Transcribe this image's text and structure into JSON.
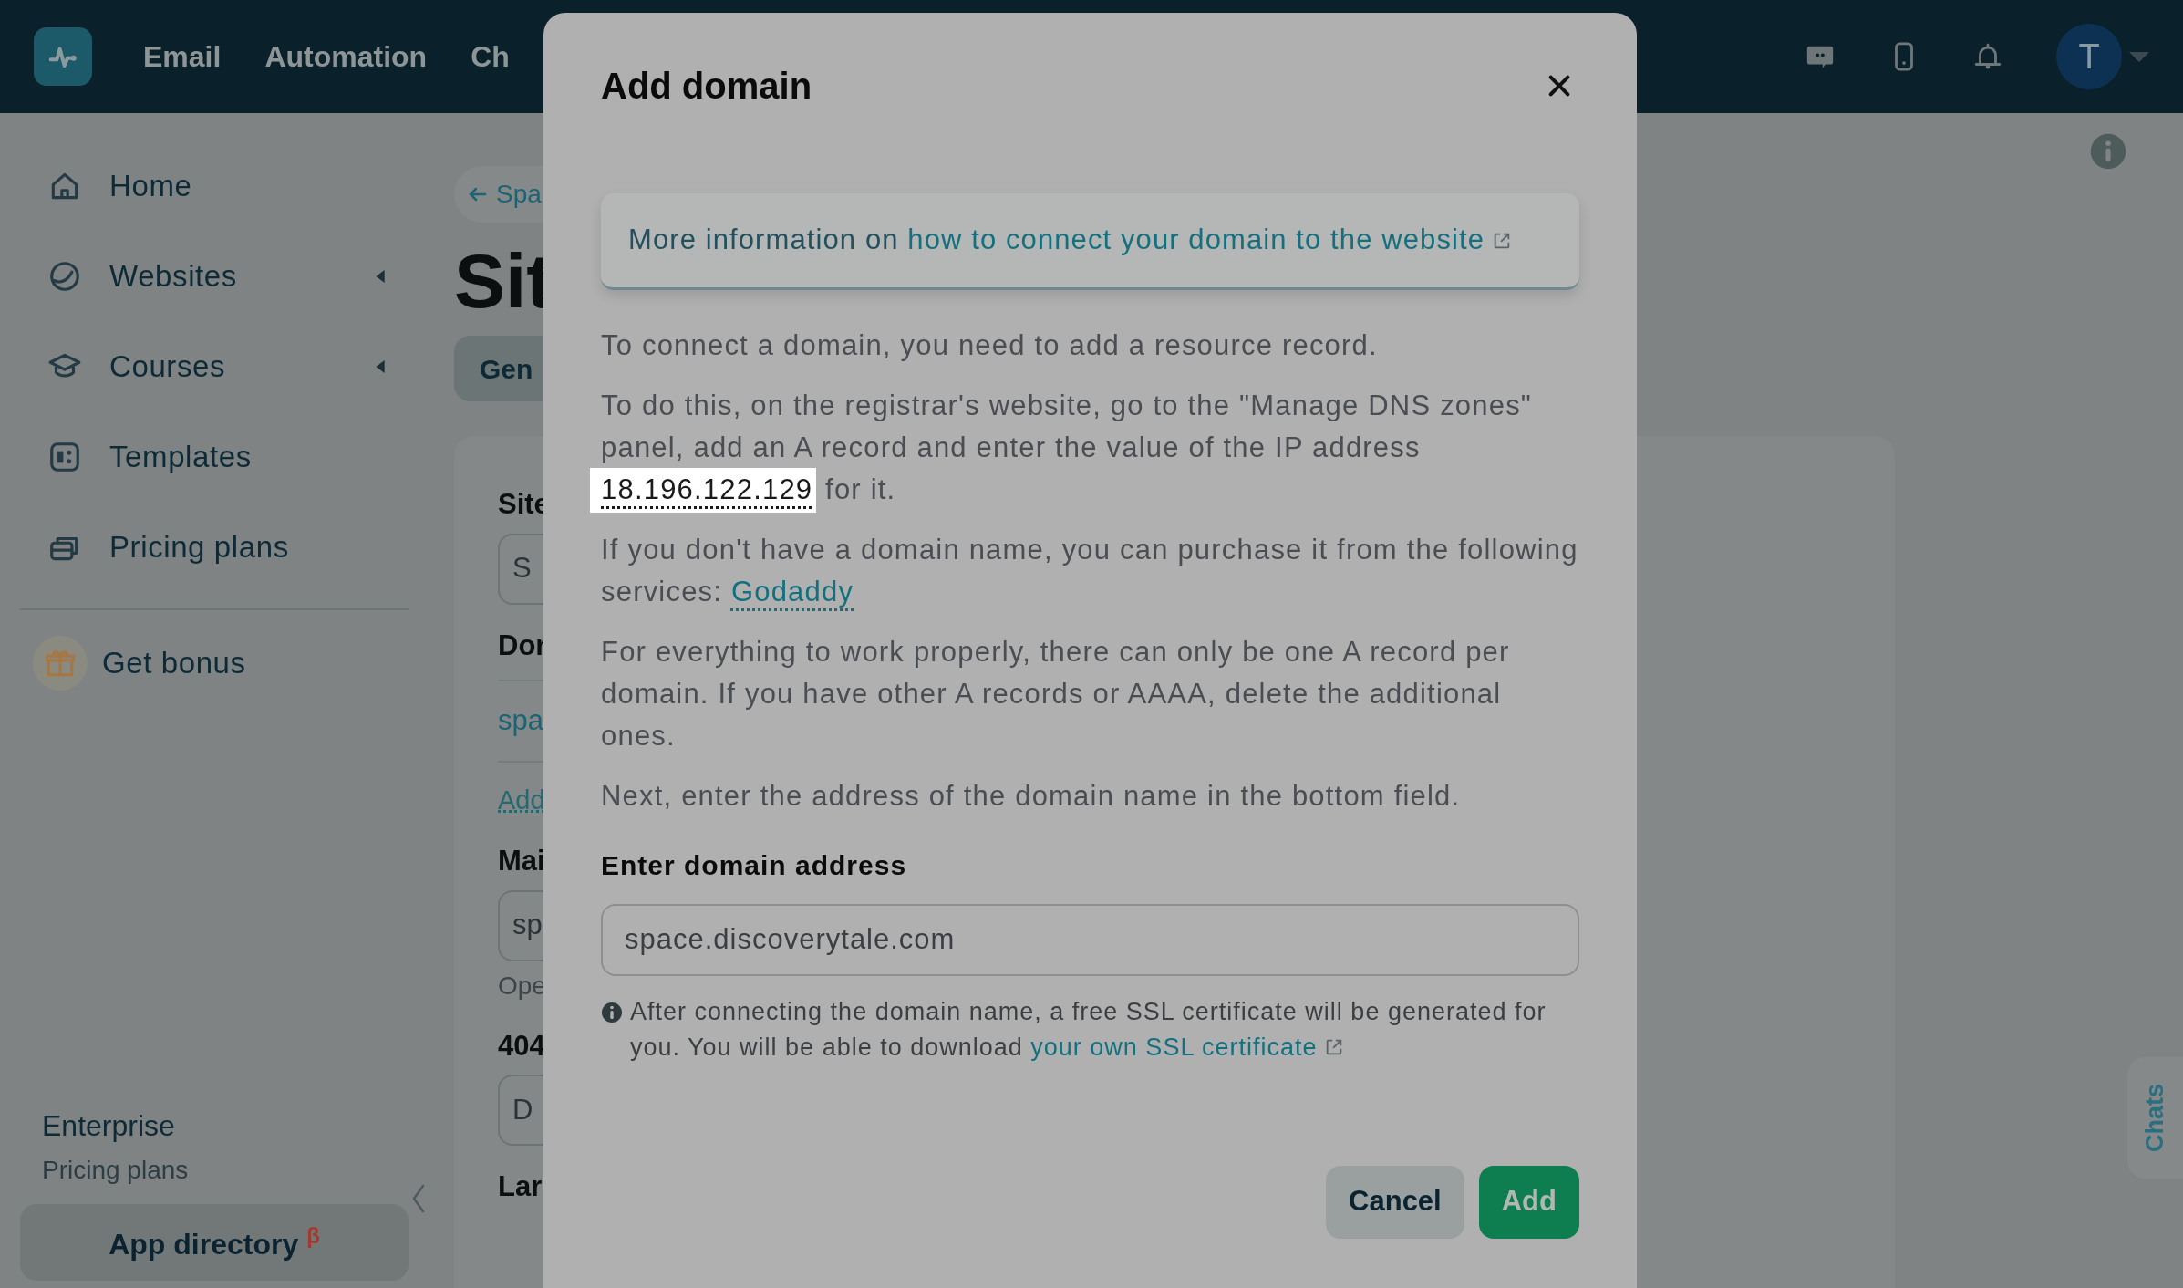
{
  "navbar": {
    "menu": [
      {
        "label": "Email"
      },
      {
        "label": "Automation"
      },
      {
        "label": "Ch"
      }
    ],
    "avatar": {
      "initial": "T"
    }
  },
  "sidebar": {
    "items": [
      {
        "label": "Home",
        "expandable": false
      },
      {
        "label": "Websites",
        "expandable": true
      },
      {
        "label": "Courses",
        "expandable": true
      },
      {
        "label": "Templates",
        "expandable": false
      },
      {
        "label": "Pricing plans",
        "expandable": false
      }
    ],
    "bonus": {
      "label": "Get bonus"
    },
    "plan": {
      "name": "Enterprise",
      "caption": "Pricing plans"
    },
    "app_directory": {
      "label": "App directory",
      "badge": "β"
    }
  },
  "page": {
    "back_link": "Spa",
    "title": "Sit",
    "tabs": [
      {
        "label": "Gen",
        "selected": true
      }
    ],
    "fields": [
      {
        "kind": "label",
        "text": "Site"
      },
      {
        "kind": "input",
        "text": "S"
      },
      {
        "kind": "label",
        "text": "Dor"
      },
      {
        "kind": "link",
        "text": "spa"
      },
      {
        "kind": "dotted_link",
        "text": "Add"
      },
      {
        "kind": "label",
        "text": "Mai"
      },
      {
        "kind": "input",
        "text": "sp"
      },
      {
        "kind": "hint",
        "text": "Ope"
      },
      {
        "kind": "label",
        "text": "404"
      },
      {
        "kind": "input",
        "text": "D"
      },
      {
        "kind": "label",
        "text": "Lar"
      }
    ],
    "chats_tab": "Chats"
  },
  "modal": {
    "title": "Add domain",
    "notice": [
      {
        "kind": "plain",
        "text": "More information on "
      },
      {
        "kind": "external_link",
        "text": "how to connect your domain to the website"
      }
    ],
    "paragraphs": [
      [
        {
          "kind": "plain",
          "text": "To connect a domain, you need to add a resource record."
        }
      ],
      [
        {
          "kind": "plain",
          "text": "To do this, on the registrar's website, go to the \"Manage DNS zones\" panel, add an A record and enter the value of the IP address "
        },
        {
          "kind": "highlight",
          "text": "18.196.122.129"
        },
        {
          "kind": "plain",
          "text": " for it."
        }
      ],
      [
        {
          "kind": "plain",
          "text": "If you don't have a domain name, you can purchase it from the following services: "
        },
        {
          "kind": "dotted_link",
          "text": "Godaddy"
        }
      ],
      [
        {
          "kind": "plain",
          "text": "For everything to work properly, there can only be one A record per domain. If you have other A records or AAAA, delete the additional ones."
        }
      ],
      [
        {
          "kind": "plain",
          "text": "Next, enter the address of the domain name in the bottom field."
        }
      ]
    ],
    "field_label": "Enter domain address",
    "field_value": "space.discoverytale.com",
    "hint": [
      {
        "kind": "plain",
        "text": "After connecting the domain name, a free SSL certificate will be generated for you. You will be able to download "
      },
      {
        "kind": "external_link",
        "text": "your own SSL certificate"
      }
    ],
    "buttons": [
      {
        "label": "Cancel",
        "kind": "secondary"
      },
      {
        "label": "Add",
        "kind": "primary"
      }
    ]
  }
}
